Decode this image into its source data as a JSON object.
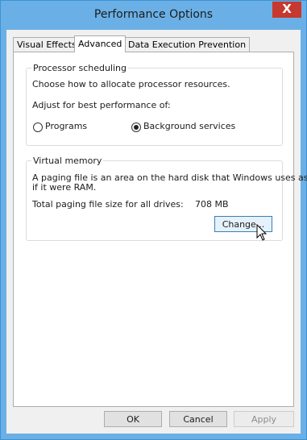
{
  "window": {
    "title": "Performance Options",
    "close_label": "X"
  },
  "tabs": [
    {
      "label": "Visual Effects",
      "active": false
    },
    {
      "label": "Advanced",
      "active": true
    },
    {
      "label": "Data Execution Prevention",
      "active": false
    }
  ],
  "processor_scheduling": {
    "title": "Processor scheduling",
    "description": "Choose how to allocate processor resources.",
    "adjust_label": "Adjust for best performance of:",
    "options": [
      {
        "label": "Programs",
        "selected": false
      },
      {
        "label": "Background services",
        "selected": true
      }
    ]
  },
  "virtual_memory": {
    "title": "Virtual memory",
    "description_line1": "A paging file is an area on the hard disk that Windows uses as",
    "description_line2": "if it were RAM.",
    "total_label": "Total paging file size for all drives:",
    "total_value": "708 MB",
    "change_button": "Change..."
  },
  "buttons": {
    "ok": "OK",
    "cancel": "Cancel",
    "apply": "Apply"
  }
}
